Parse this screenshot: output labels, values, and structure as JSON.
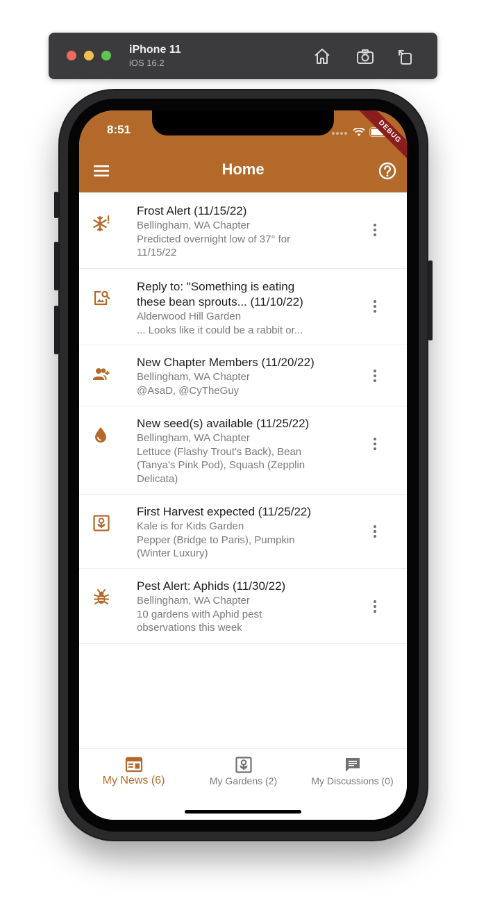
{
  "simulator": {
    "device": "iPhone 11",
    "os": "iOS 16.2"
  },
  "status_bar": {
    "time": "8:51",
    "debug_banner": "DEBUG"
  },
  "app_bar": {
    "title": "Home"
  },
  "news_items": [
    {
      "icon": "frost-alert-icon",
      "title": "Frost Alert (11/15/22)",
      "subtitle": "Bellingham, WA Chapter",
      "detail_lines": [
        "Predicted overnight low of 37° for",
        "11/15/22"
      ]
    },
    {
      "icon": "image-search-icon",
      "title_lines": [
        "Reply to: \"Something is eating",
        "these bean sprouts... (11/10/22)"
      ],
      "subtitle": "Alderwood Hill Garden",
      "detail_lines": [
        "... Looks like it could be a rabbit or..."
      ]
    },
    {
      "icon": "group-add-icon",
      "title": "New Chapter Members (11/20/22)",
      "subtitle": "Bellingham, WA Chapter",
      "detail_lines": [
        "@AsaD, @CyTheGuy"
      ]
    },
    {
      "icon": "water-drop-icon",
      "title": "New seed(s) available (11/25/22)",
      "subtitle": "Bellingham, WA Chapter",
      "detail_lines": [
        "Lettuce (Flashy Trout's Back), Bean",
        "(Tanya's Pink Pod), Squash (Zepplin",
        "Delicata)"
      ]
    },
    {
      "icon": "garden-icon",
      "title": "First Harvest expected (11/25/22)",
      "subtitle": "Kale is for Kids Garden",
      "detail_lines": [
        "Pepper (Bridge to Paris), Pumpkin",
        "(Winter Luxury)"
      ]
    },
    {
      "icon": "bug-icon",
      "title": "Pest Alert: Aphids (11/30/22)",
      "subtitle": "Bellingham, WA Chapter",
      "detail_lines": [
        "10 gardens with Aphid pest",
        "observations this week"
      ]
    }
  ],
  "bottom_nav": {
    "tabs": [
      {
        "label": "My News (6)",
        "icon": "news-icon",
        "active": true
      },
      {
        "label": "My Gardens (2)",
        "icon": "garden-icon",
        "active": false
      },
      {
        "label": "My Discussions (0)",
        "icon": "chat-icon",
        "active": false
      }
    ]
  },
  "colors": {
    "accent": "#b2692a",
    "inactive": "#7a7a7a"
  }
}
